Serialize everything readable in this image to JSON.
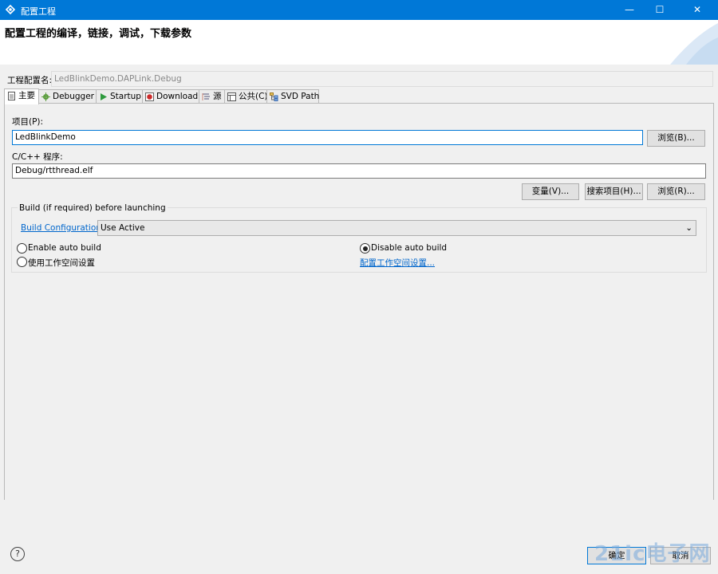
{
  "window": {
    "title": "配置工程",
    "minimize_glyph": "—",
    "maximize_glyph": "☐",
    "close_glyph": "✕"
  },
  "header": {
    "banner": "配置工程的编译，链接，调试，下载参数"
  },
  "config": {
    "name_label": "工程配置名:",
    "name_value": "LedBlinkDemo.DAPLink.Debug"
  },
  "tabs": [
    {
      "label": "主要",
      "icon": "document-icon"
    },
    {
      "label": "Debugger",
      "icon": "bug-gear-icon"
    },
    {
      "label": "Startup",
      "icon": "play-icon"
    },
    {
      "label": "Download",
      "icon": "download-icon"
    },
    {
      "label": "源",
      "icon": "source-icon"
    },
    {
      "label": "公共(C)",
      "icon": "common-icon"
    },
    {
      "label": "SVD Path",
      "icon": "svd-tree-icon"
    }
  ],
  "main": {
    "project_label": "项目(P):",
    "project_value": "LedBlinkDemo",
    "browse1": "浏览(B)...",
    "program_label": "C/C++ 程序:",
    "program_value": "Debug/rtthread.elf",
    "variables_btn": "变量(V)...",
    "search_btn": "搜索项目(H)...",
    "browse2": "浏览(R)..."
  },
  "build": {
    "group_title": "Build (if required) before launching",
    "config_link": "Build Configuration:",
    "config_value": "Use Active",
    "enable_auto": "Enable auto build",
    "disable_auto": "Disable auto build",
    "workspace_setting": "使用工作空间设置",
    "workspace_link": "配置工作空间设置...",
    "selected": "disable_auto"
  },
  "footer": {
    "help": "?",
    "ok": "确定",
    "cancel": "取消",
    "watermark": "21ic电子网"
  },
  "colors": {
    "titlebar": "#0078d7",
    "link": "#0066cc",
    "background": "#f0f0f0"
  }
}
